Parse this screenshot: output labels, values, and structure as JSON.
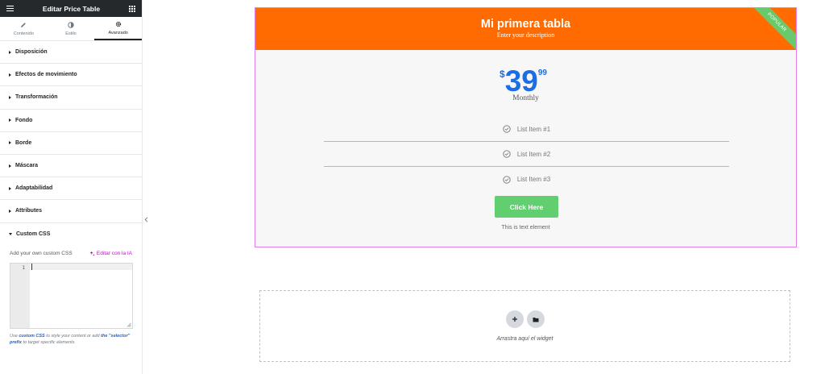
{
  "panel": {
    "title": "Editar Price Table",
    "tabs": [
      {
        "label": "Contenido",
        "icon": "pencil-icon"
      },
      {
        "label": "Estilo",
        "icon": "contrast-icon"
      },
      {
        "label": "Avanzado",
        "icon": "gear-icon",
        "active": true
      }
    ],
    "sections": [
      {
        "label": "Disposición"
      },
      {
        "label": "Efectos de movimiento"
      },
      {
        "label": "Transformación"
      },
      {
        "label": "Fondo"
      },
      {
        "label": "Borde"
      },
      {
        "label": "Máscara"
      },
      {
        "label": "Adaptabilidad"
      },
      {
        "label": "Attributes"
      },
      {
        "label": "Custom CSS",
        "open": true
      }
    ],
    "custom_css": {
      "label": "Add your own custom CSS",
      "ai_link": "Editar con la IA",
      "line_number": "1",
      "help_prefix": "Use",
      "help_link1": "custom CSS",
      "help_mid": "to style your content or add",
      "help_link2": "the \"selector\" prefix",
      "help_suffix": "to target specific elements."
    }
  },
  "price_table": {
    "title": "Mi primera tabla",
    "description": "Enter your description",
    "ribbon": "POPULAR",
    "currency": "$",
    "price_integer": "39",
    "price_cents": "99",
    "period": "Monthly",
    "items": [
      "List Item #1",
      "List Item #2",
      "List Item #3"
    ],
    "button_label": "Click Here",
    "footer_text": "This is text element"
  },
  "dropzone": {
    "text": "Arrastra aquí el widget"
  },
  "colors": {
    "header": "#ff6b00",
    "price": "#1a6ee8",
    "button": "#61ce70",
    "ribbon": "#69c96d",
    "selection_border": "#e27cf0",
    "ai_accent": "#d004d4"
  }
}
